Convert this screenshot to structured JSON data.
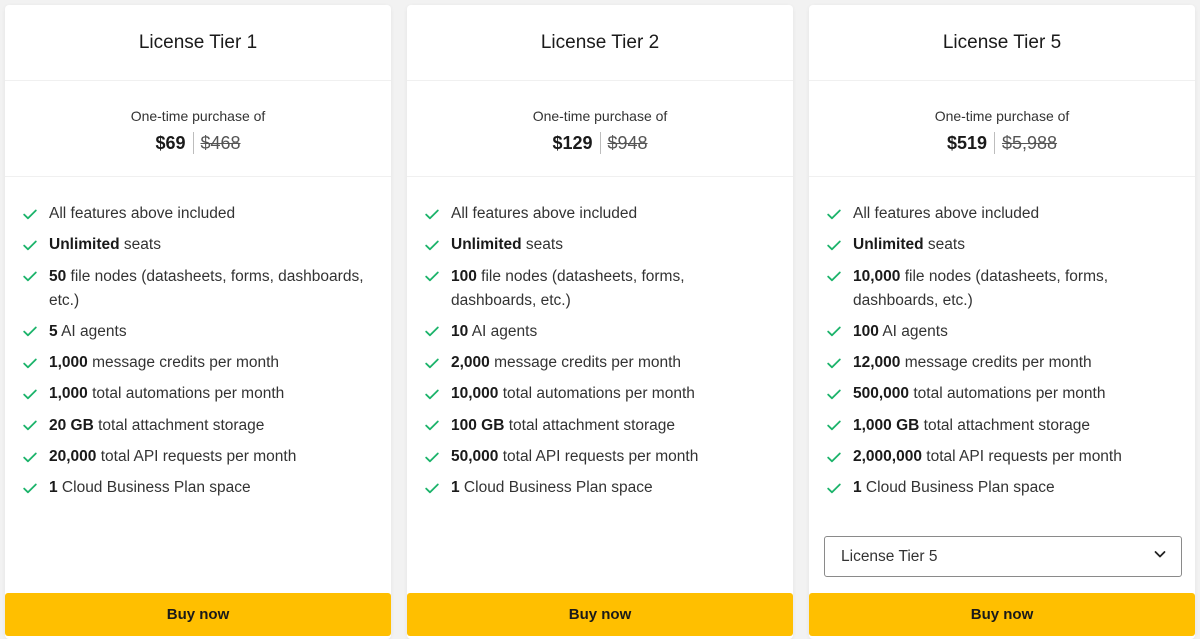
{
  "colors": {
    "accent": "#ffbf00",
    "check": "#1bb36a"
  },
  "tiers": [
    {
      "title": "License Tier 1",
      "price_caption": "One-time purchase of",
      "price_now": "$69",
      "price_old": "$468",
      "buy_label": "Buy now",
      "features": [
        {
          "bold": "",
          "text": "All features above included"
        },
        {
          "bold": "Unlimited",
          "text": " seats"
        },
        {
          "bold": "50",
          "text": " file nodes (datasheets, forms, dashboards, etc.)"
        },
        {
          "bold": "5",
          "text": " AI agents"
        },
        {
          "bold": "1,000",
          "text": " message credits per month"
        },
        {
          "bold": "1,000",
          "text": " total automations per month"
        },
        {
          "bold": "20 GB",
          "text": " total attachment storage"
        },
        {
          "bold": "20,000",
          "text": " total API requests per month"
        },
        {
          "bold": "1",
          "text": " Cloud Business Plan space"
        }
      ]
    },
    {
      "title": "License Tier 2",
      "price_caption": "One-time purchase of",
      "price_now": "$129",
      "price_old": "$948",
      "buy_label": "Buy now",
      "features": [
        {
          "bold": "",
          "text": "All features above included"
        },
        {
          "bold": "Unlimited",
          "text": " seats"
        },
        {
          "bold": "100",
          "text": " file nodes (datasheets, forms, dashboards, etc.)"
        },
        {
          "bold": "10",
          "text": " AI agents"
        },
        {
          "bold": "2,000",
          "text": " message credits per month"
        },
        {
          "bold": "10,000",
          "text": " total automations per month"
        },
        {
          "bold": "100 GB",
          "text": " total attachment storage"
        },
        {
          "bold": "50,000",
          "text": " total API requests per month"
        },
        {
          "bold": "1",
          "text": " Cloud Business Plan space"
        }
      ]
    },
    {
      "title": "License Tier 5",
      "price_caption": "One-time purchase of",
      "price_now": "$519",
      "price_old": "$5,988",
      "buy_label": "Buy now",
      "select_value": "License Tier 5",
      "features": [
        {
          "bold": "",
          "text": "All features above included"
        },
        {
          "bold": "Unlimited",
          "text": " seats"
        },
        {
          "bold": "10,000",
          "text": " file nodes (datasheets, forms, dashboards, etc.)"
        },
        {
          "bold": "100",
          "text": " AI agents"
        },
        {
          "bold": "12,000",
          "text": " message credits per month"
        },
        {
          "bold": "500,000",
          "text": " total automations per month"
        },
        {
          "bold": "1,000 GB",
          "text": " total attachment storage"
        },
        {
          "bold": "2,000,000",
          "text": " total API requests per month"
        },
        {
          "bold": "1",
          "text": " Cloud Business Plan space"
        }
      ]
    }
  ]
}
